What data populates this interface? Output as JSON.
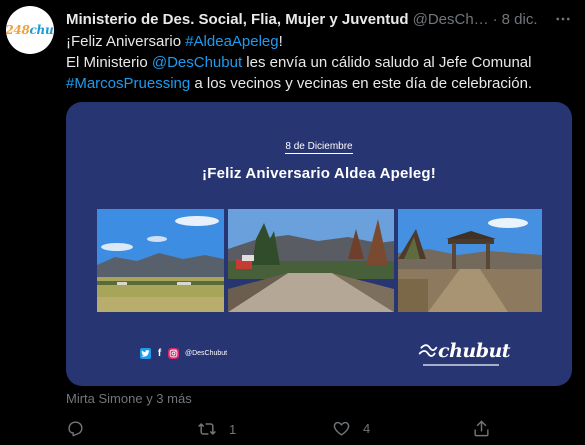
{
  "tweet": {
    "author_name": "Ministerio de Des. Social, Flia, Mujer y Juventud",
    "handle": "@DesCh…",
    "separator": "·",
    "date": "8 dic.",
    "avatar_text": "chubut",
    "text": {
      "line1_prefix": "¡Feliz Aniversario ",
      "line1_hashtag": "#AldeaApeleg",
      "line1_suffix": "!",
      "line2_prefix": "El Ministerio ",
      "line2_mention": "@DesChubut",
      "line2_suffix": " les envía un cálido saludo al Jefe Comunal",
      "line3_hashtag": "#MarcosPruessing",
      "line3_suffix": " a los vecinos y vecinas en este día de celebración."
    }
  },
  "card": {
    "date": "8 de Diciembre",
    "title": "¡Feliz Aniversario Aldea Apeleg!",
    "social_handle": "@DesChubut",
    "logo_text": "chubut",
    "background_color": "#273572"
  },
  "liked_by": "Mirta Simone y 3 más",
  "actions": {
    "reply_count": "",
    "retweet_count": "1",
    "like_count": "4"
  },
  "icons": [
    "more-icon",
    "reply-icon",
    "retweet-icon",
    "like-icon",
    "share-icon",
    "twitter-icon",
    "facebook-icon",
    "instagram-icon"
  ],
  "colors": {
    "background": "#000000",
    "text": "#e7e9ea",
    "muted": "#71767b",
    "link": "#1d9bf0"
  }
}
